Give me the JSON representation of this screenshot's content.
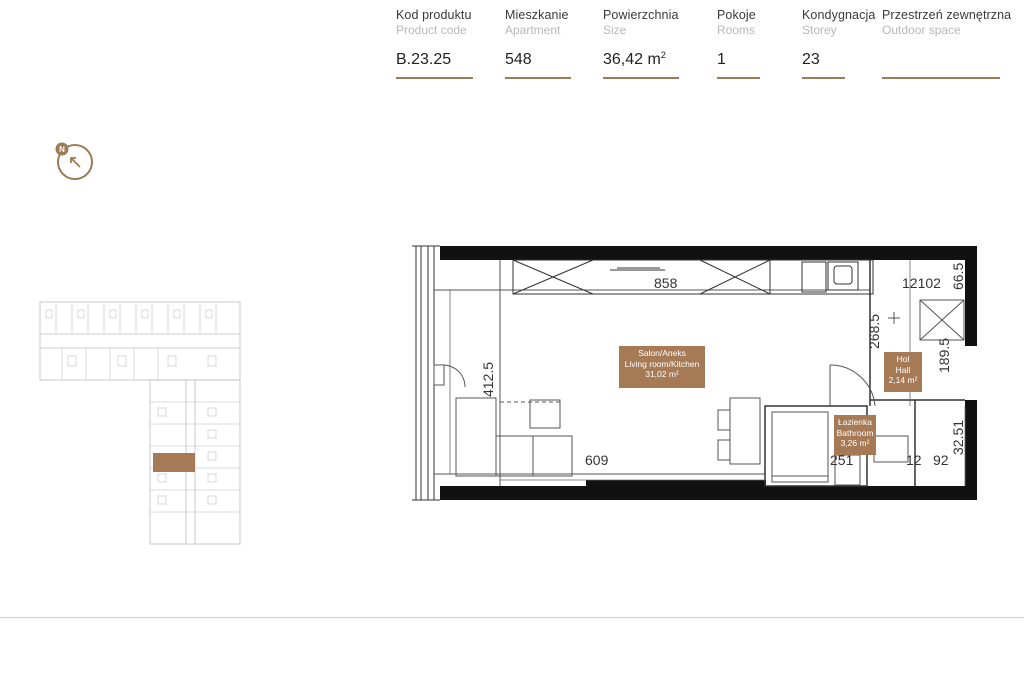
{
  "specs": [
    {
      "label_pl": "Kod produktu",
      "label_en": "Product code",
      "value": "B.23.25",
      "unit": ""
    },
    {
      "label_pl": "Mieszkanie",
      "label_en": "Apartment",
      "value": "548",
      "unit": ""
    },
    {
      "label_pl": "Powierzchnia",
      "label_en": "Size",
      "value": "36,42 m",
      "unit": "2"
    },
    {
      "label_pl": "Pokoje",
      "label_en": "Rooms",
      "value": "1",
      "unit": ""
    },
    {
      "label_pl": "Kondygnacja",
      "label_en": "Storey",
      "value": "23",
      "unit": ""
    },
    {
      "label_pl": "Przestrzeń zewnętrzna",
      "label_en": "Outdoor space",
      "value": "",
      "unit": ""
    }
  ],
  "compass": {
    "letter": "N"
  },
  "rooms": {
    "living": {
      "l1": "Salon/Aneks",
      "l2": "Living room/Kitchen",
      "area": "31,02 m²"
    },
    "hall": {
      "l1": "Hol",
      "l2": "Hall",
      "area": "2,14 m²"
    },
    "bath": {
      "l1": "Łazienka",
      "l2": "Bathroom",
      "area": "3,26 m²"
    }
  },
  "dimensions": {
    "d858": "858",
    "d609": "609",
    "d4125": "412.5",
    "d12102": "12102",
    "d665": "66.5",
    "d2685": "268.5",
    "d1895": "189.5",
    "d251": "251",
    "d12": "12",
    "d92": "92",
    "d3251": "32.51"
  },
  "colors": {
    "accent": "#9c7b55",
    "wall": "#111111",
    "label_bg": "#a57a55"
  }
}
